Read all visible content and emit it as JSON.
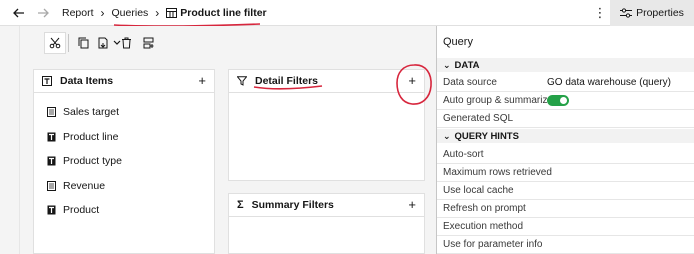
{
  "breadcrumb": {
    "report": "Report",
    "queries": "Queries",
    "current": "Product line filter"
  },
  "topbar": {
    "kebab": "⋮",
    "properties_label": "Properties"
  },
  "panels": {
    "data_items": {
      "title": "Data Items",
      "plus": "+",
      "items": [
        "Sales target",
        "Product line",
        "Product type",
        "Revenue",
        "Product"
      ]
    },
    "detail_filters": {
      "title": "Detail Filters",
      "plus": "+"
    },
    "summary_filters": {
      "title": "Summary Filters",
      "plus": "+"
    }
  },
  "properties": {
    "title": "Query",
    "sections": {
      "data": {
        "label": "DATA",
        "rows": {
          "data_source": {
            "label": "Data source",
            "value": "GO data warehouse (query)"
          },
          "auto_group": {
            "label": "Auto group & summarize",
            "toggle": true
          },
          "generated_sql": {
            "label": "Generated SQL"
          }
        }
      },
      "query_hints": {
        "label": "QUERY HINTS",
        "rows": [
          "Auto-sort",
          "Maximum rows retrieved",
          "Use local cache",
          "Refresh on prompt",
          "Execution method",
          "Use for parameter info"
        ]
      }
    }
  },
  "colors": {
    "accent_toggle": "#24a148",
    "annotation": "#d7263d"
  }
}
